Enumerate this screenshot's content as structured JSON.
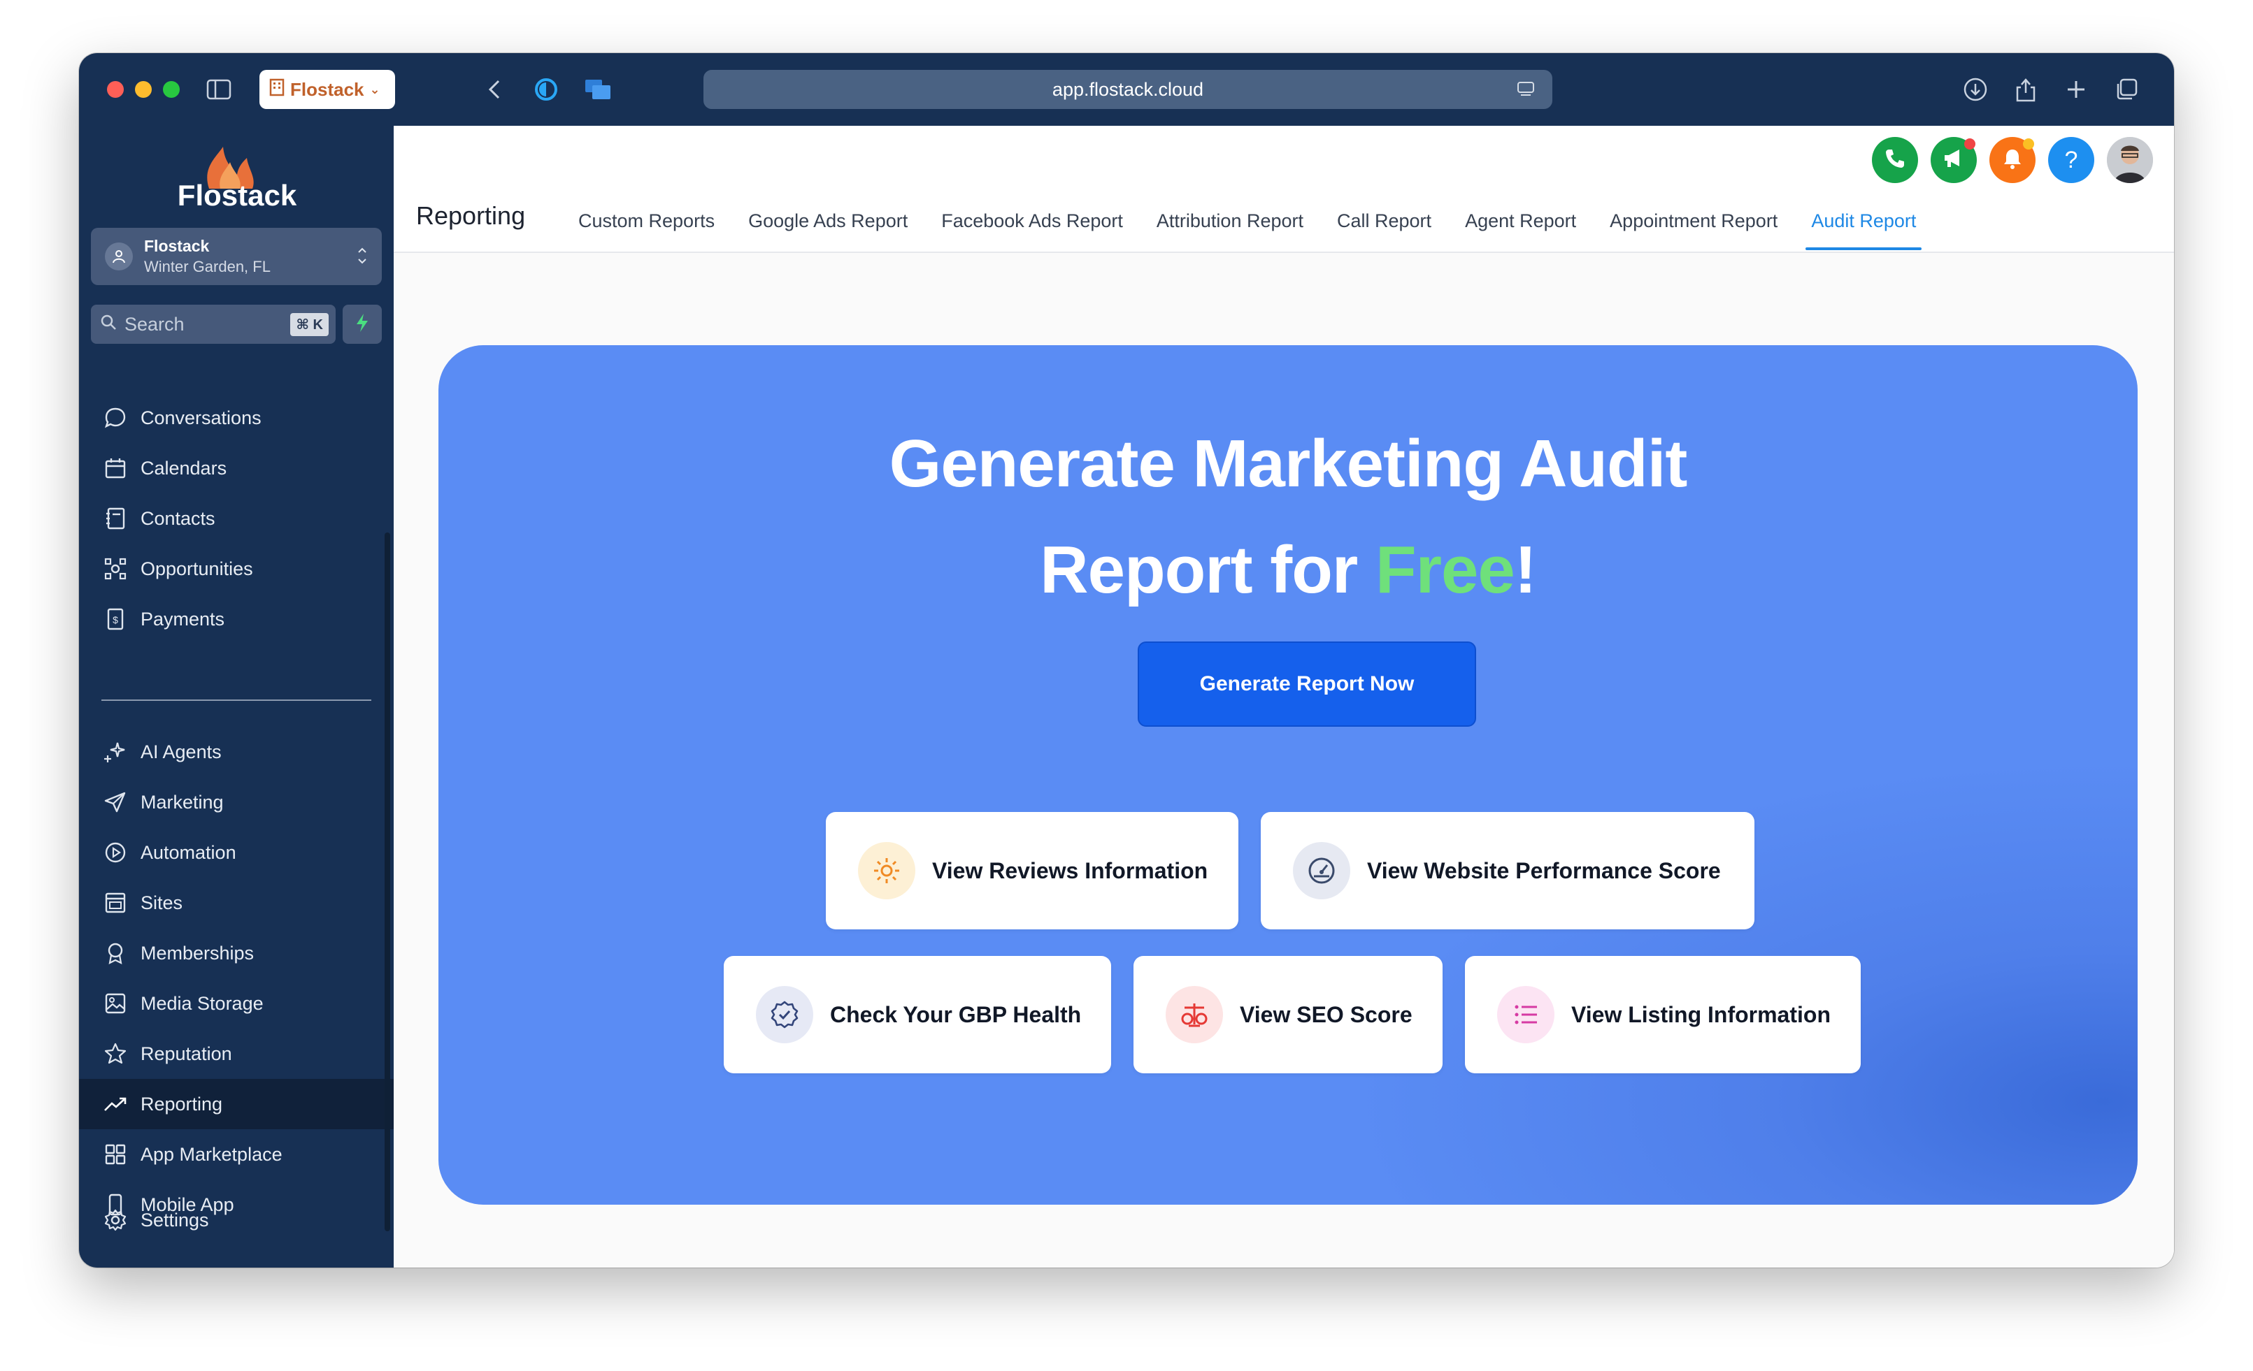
{
  "browser": {
    "tab_label": "Flostack",
    "url": "app.flostack.cloud"
  },
  "sidebar": {
    "logo_text": "Flostack",
    "account": {
      "name": "Flostack",
      "location": "Winter Garden, FL"
    },
    "search": {
      "placeholder": "Search",
      "shortcut": "⌘ K"
    },
    "items_top": [
      {
        "label": "Conversations",
        "icon": "chat-bubble-icon"
      },
      {
        "label": "Calendars",
        "icon": "calendar-icon"
      },
      {
        "label": "Contacts",
        "icon": "contacts-icon"
      },
      {
        "label": "Opportunities",
        "icon": "opportunities-icon"
      },
      {
        "label": "Payments",
        "icon": "payments-icon"
      }
    ],
    "items_bottom": [
      {
        "label": "AI Agents",
        "icon": "sparkles-icon"
      },
      {
        "label": "Marketing",
        "icon": "paper-plane-icon"
      },
      {
        "label": "Automation",
        "icon": "play-circle-icon"
      },
      {
        "label": "Sites",
        "icon": "sites-icon"
      },
      {
        "label": "Memberships",
        "icon": "award-icon"
      },
      {
        "label": "Media Storage",
        "icon": "image-icon"
      },
      {
        "label": "Reputation",
        "icon": "star-icon"
      },
      {
        "label": "Reporting",
        "icon": "trend-up-icon",
        "active": true
      },
      {
        "label": "App Marketplace",
        "icon": "grid-icon"
      },
      {
        "label": "Mobile App",
        "icon": "mobile-icon"
      }
    ],
    "settings_label": "Settings"
  },
  "header": {
    "page_title": "Reporting",
    "tabs": [
      "Custom Reports",
      "Google Ads Report",
      "Facebook Ads Report",
      "Attribution Report",
      "Call Report",
      "Agent Report",
      "Appointment Report",
      "Audit Report"
    ],
    "active_tab": "Audit Report",
    "help_symbol": "?"
  },
  "hero": {
    "title_line1": "Generate Marketing Audit",
    "title_line2_prefix": "Report for ",
    "title_highlight": "Free",
    "title_suffix": "!",
    "cta_label": "Generate Report Now",
    "features": [
      "View Reviews Information",
      "View Website Performance Score",
      "Check Your GBP Health",
      "View SEO Score",
      "View Listing Information"
    ]
  },
  "colors": {
    "sidebar_bg": "#173054",
    "hero_bg": "#5a8cf4",
    "accent": "#1e88e5",
    "cta": "#1560ec",
    "highlight": "#6fe07b"
  }
}
